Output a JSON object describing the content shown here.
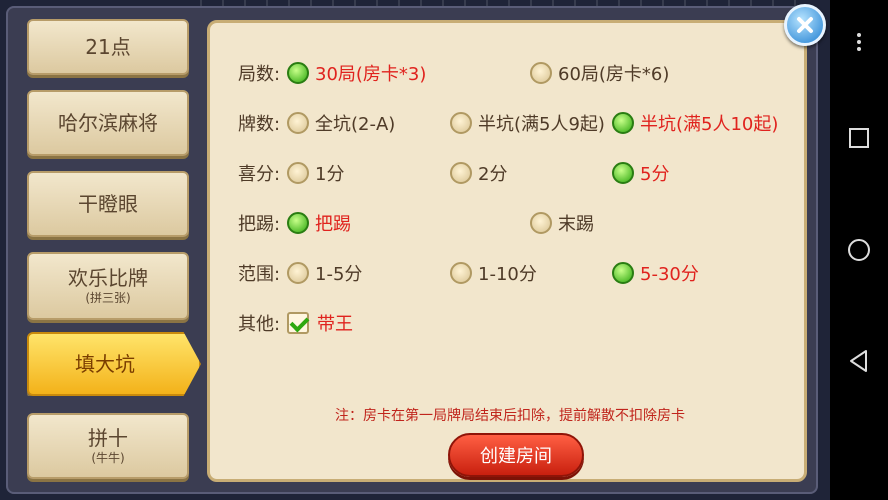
{
  "sidebar": {
    "tabs": [
      {
        "label": "21点",
        "sub": ""
      },
      {
        "label": "哈尔滨麻将",
        "sub": ""
      },
      {
        "label": "干瞪眼",
        "sub": ""
      },
      {
        "label": "欢乐比牌",
        "sub": "(拼三张)"
      },
      {
        "label": "填大坑",
        "sub": ""
      },
      {
        "label": "拼十",
        "sub": "(牛牛)"
      }
    ],
    "active_index": 4
  },
  "settings": {
    "rounds": {
      "label": "局数:",
      "options": [
        "30局(房卡*3)",
        "60局(房卡*6)"
      ],
      "selected": 0
    },
    "cards": {
      "label": "牌数:",
      "options": [
        "全坑(2-A)",
        "半坑(满5人9起)",
        "半坑(满5人10起)"
      ],
      "selected": 2
    },
    "bonus": {
      "label": "喜分:",
      "options": [
        "1分",
        "2分",
        "5分"
      ],
      "selected": 2
    },
    "kick": {
      "label": "把踢:",
      "options": [
        "把踢",
        "末踢"
      ],
      "selected": 0
    },
    "range": {
      "label": "范围:",
      "options": [
        "1-5分",
        "1-10分",
        "5-30分"
      ],
      "selected": 2
    },
    "other": {
      "label": "其他:",
      "options": [
        "带王"
      ],
      "checked": true
    }
  },
  "note": "注：房卡在第一局牌局结束后扣除，提前解散不扣除房卡",
  "create_label": "创建房间",
  "colors": {
    "selected_text": "#e0231e",
    "radio_on": "#2ea80f",
    "accent_button": "#d9301b"
  },
  "icons": {
    "close": "close-icon",
    "menu": "more-vert-icon",
    "recent": "square-icon",
    "home": "circle-icon",
    "back": "triangle-back-icon"
  }
}
